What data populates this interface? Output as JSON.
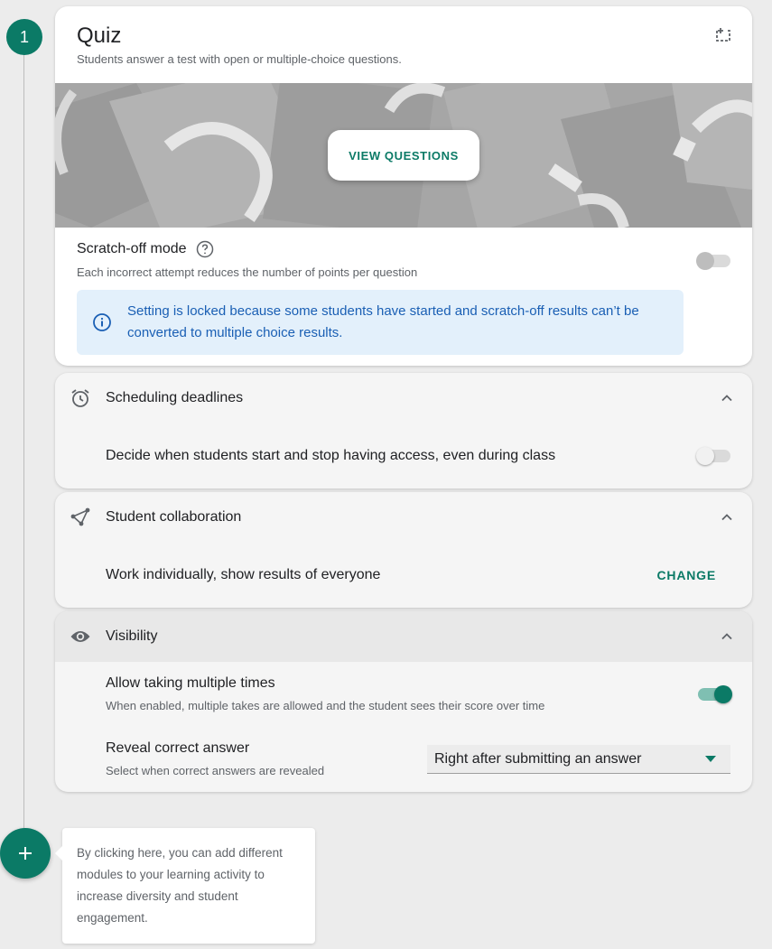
{
  "step": {
    "number": "1"
  },
  "quiz": {
    "title": "Quiz",
    "subtitle": "Students answer a test with open or multiple-choice questions.",
    "view_questions_label": "VIEW QUESTIONS",
    "scratch_off": {
      "title": "Scratch-off mode",
      "description": "Each incorrect attempt reduces the number of points per question",
      "enabled": false
    },
    "locked_notice": "Setting is locked because some students have started and scratch-off results can’t be converted to multiple choice results."
  },
  "scheduling": {
    "title": "Scheduling deadlines",
    "option_label": "Decide when students start and stop having access, even during class",
    "enabled": false
  },
  "collaboration": {
    "title": "Student collaboration",
    "value": "Work individually, show results of everyone",
    "change_label": "CHANGE"
  },
  "visibility": {
    "title": "Visibility",
    "multiple_takes": {
      "title": "Allow taking multiple times",
      "description": "When enabled, multiple takes are allowed and the student sees their score over time",
      "enabled": true
    },
    "reveal_answer": {
      "title": "Reveal correct answer",
      "description": "Select when correct answers are revealed",
      "selected": "Right after submitting an answer"
    }
  },
  "add_module": {
    "tooltip": "By clicking here, you can add different modules to your learning activity to increase diversity and student engagement."
  },
  "colors": {
    "accent": "#0b7a66",
    "info_background": "#e3f0fb",
    "info_text": "#1a5fb4"
  }
}
